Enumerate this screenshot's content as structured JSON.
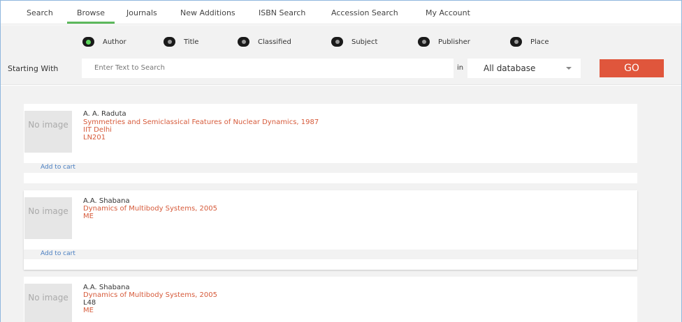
{
  "nav": {
    "tabs": [
      "Search",
      "Browse",
      "Journals",
      "New Additions",
      "ISBN Search",
      "Accession Search",
      "My Account"
    ],
    "active": "Browse"
  },
  "search": {
    "options": [
      "Author",
      "Title",
      "Classified",
      "Subject",
      "Publisher",
      "Place"
    ],
    "selected": "Author",
    "starting_with_label": "Starting With",
    "placeholder": "Enter Text to Search",
    "in_label": "in",
    "database": "All database",
    "go_label": "GO"
  },
  "results": [
    {
      "image_text": "No image",
      "author": "A. A. Raduta",
      "lines": [
        "Symmetries and Semiclassical Features of Nuclear Dynamics, 1987",
        "IIT Delhi",
        "LN201"
      ],
      "cart_label": "Add to cart"
    },
    {
      "image_text": "No image",
      "author": "A.A. Shabana",
      "lines": [
        "Dynamics of Multibody Systems, 2005",
        "ME"
      ],
      "cart_label": "Add to cart"
    },
    {
      "image_text": "No image",
      "author": "A.A. Shabana",
      "lines": [
        "Dynamics of Multibody Systems, 2005",
        "L48",
        "ME"
      ],
      "cart_label": ""
    }
  ],
  "colors": {
    "accent_green": "#5cb85c",
    "go_button": "#e0563c",
    "result_link": "#d65a3a",
    "cart_link": "#4a7fc1"
  }
}
